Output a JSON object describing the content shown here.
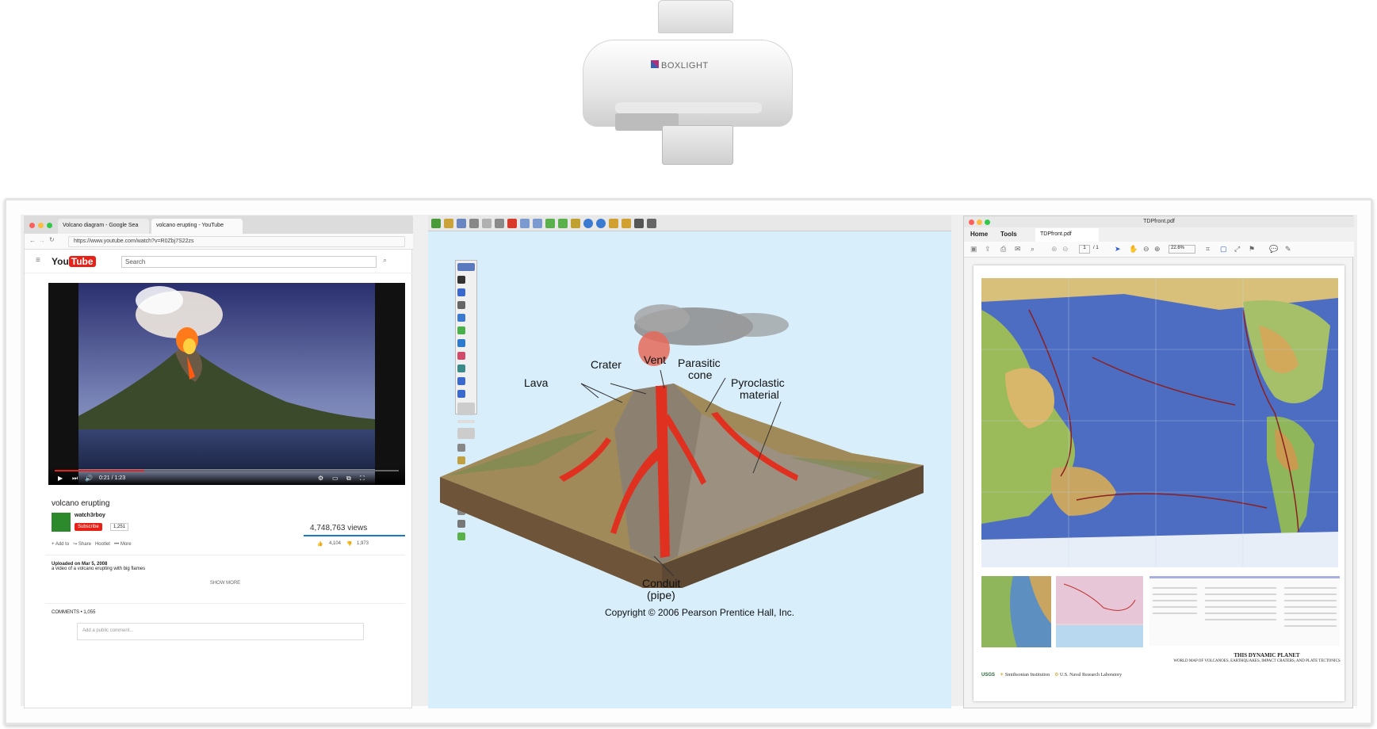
{
  "projector": {
    "brand": "BOXLIGHT"
  },
  "youtube": {
    "tabs": [
      "Volcano diagram - Google Sea",
      "volcano erupting - YouTube"
    ],
    "url": "https://www.youtube.com/watch?v=R0Zbj7S22zs",
    "logo": "You",
    "logo_tube": "Tube",
    "search_placeholder": "Search",
    "time": "0:21 / 1:23",
    "progress": 0.26,
    "title": "volcano erupting",
    "channel": "watch3rboy",
    "subscribe": "Subscribe",
    "subscriber_count": "1,251",
    "views": "4,748,763 views",
    "actions": {
      "add_to": "Add to",
      "share": "Share",
      "hootlet": "Hootlet",
      "more": "More",
      "likes": "4,104",
      "dislikes": "1,973"
    },
    "uploaded": "Uploaded on Mar 5, 2008",
    "description": "a video of a volcano erupting with big flames",
    "show_more": "SHOW MORE",
    "comments_header": "COMMENTS • 1,055",
    "comment_placeholder": "Add a public comment..."
  },
  "volcano": {
    "labels": {
      "crater": "Crater",
      "vent": "Vent",
      "parasitic": "Parasitic",
      "cone": "cone",
      "lava": "Lava",
      "pyroclastic": "Pyroclastic",
      "material": "material",
      "conduit": "Conduit",
      "pipe": "(pipe)"
    },
    "copyright": "Copyright © 2006 Pearson Prentice Hall, Inc."
  },
  "pdf": {
    "window_title": "TDPfront.pdf",
    "menu": {
      "home": "Home",
      "tools": "Tools",
      "tab": "TDPfront.pdf"
    },
    "page": "1",
    "page_total": "/ 1",
    "zoom": "22.6%",
    "poster_title": "THIS DYNAMIC PLANET",
    "poster_subtitle": "WORLD MAP OF VOLCANOES, EARTHQUAKES, IMPACT CRATERS, AND PLATE TECTONICS",
    "logos": {
      "usgs": "USGS",
      "smithsonian": "Smithsonian Institution",
      "navy": "U.S. Naval Research Laboratory"
    }
  }
}
